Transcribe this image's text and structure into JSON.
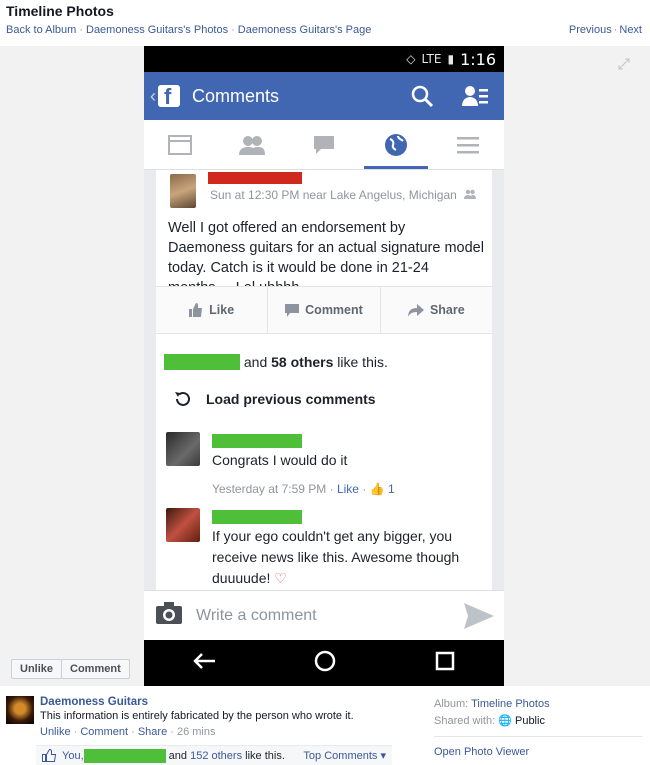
{
  "header": {
    "title": "Timeline Photos",
    "breadcrumbs": [
      "Back to Album",
      "Daemoness Guitars's Photos",
      "Daemoness Guitars's Page"
    ],
    "nav": {
      "previous": "Previous",
      "next": "Next"
    }
  },
  "phone": {
    "status_time": "1:16",
    "status_network": "LTE",
    "appbar_title": "Comments",
    "tabs": [
      "news-feed",
      "friends",
      "messages",
      "notifications",
      "menu"
    ],
    "active_tab": "notifications",
    "post": {
      "meta": "Sun at 12:30 PM near Lake Angelus, Michigan",
      "text": "Well I got offered an endorsement by Daemoness guitars for an actual signature model today. Catch is it would be done in 21-24 months.... Lol uhhhh",
      "actions": {
        "like": "Like",
        "comment": "Comment",
        "share": "Share"
      },
      "likes_tail": " and ",
      "likes_bold": "58 others",
      "likes_end": " like this."
    },
    "load_previous": "Load previous comments",
    "comments": [
      {
        "text": "Congrats I would do it",
        "time": "Yesterday at 7:59 PM",
        "like_label": "Like",
        "like_count": "1"
      },
      {
        "text": "If your ego couldn't get any bigger, you receive news like this. Awesome though duuuude!",
        "heart": "♡"
      }
    ],
    "composer_placeholder": "Write a comment"
  },
  "buttons": {
    "unlike": "Unlike",
    "comment": "Comment"
  },
  "footer": {
    "page_name": "Daemoness Guitars",
    "caption": "This information is entirely fabricated by the person who wrote it.",
    "links": {
      "unlike": "Unlike",
      "comment": "Comment",
      "share": "Share",
      "time": "26 mins"
    },
    "likes": {
      "you": "You,",
      "and": " and ",
      "others": "152 others",
      "end": " like this."
    },
    "top_comments": "Top Comments",
    "album_label": "Album:",
    "album_value": "Timeline Photos",
    "shared_label": "Shared with:",
    "shared_value": "Public",
    "open_viewer": "Open Photo Viewer"
  },
  "colors": {
    "fb_blue": "#4267b2",
    "redaction_green": "#4fbf3a",
    "redaction_red": "#d0281e"
  }
}
